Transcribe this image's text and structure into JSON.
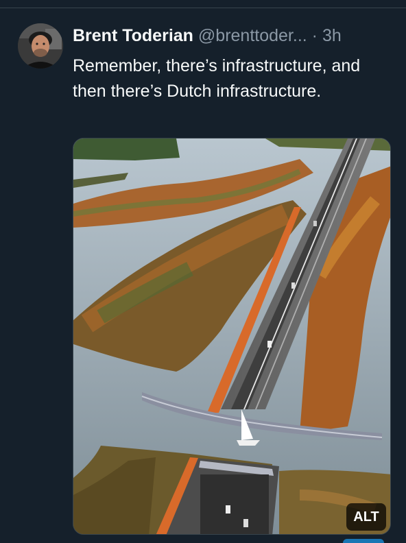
{
  "tweet": {
    "author_name": "Brent Toderian",
    "handle": "@brenttoder...",
    "separator": "·",
    "time": "3h",
    "text": "Remember, there’s infrastructure, and then there’s Dutch infrastructure.",
    "media": {
      "alt_badge": "ALT"
    }
  },
  "colors": {
    "background": "#15202b",
    "text_primary": "#f7f9f9",
    "text_secondary": "#8b98a5",
    "border": "#38444d"
  }
}
